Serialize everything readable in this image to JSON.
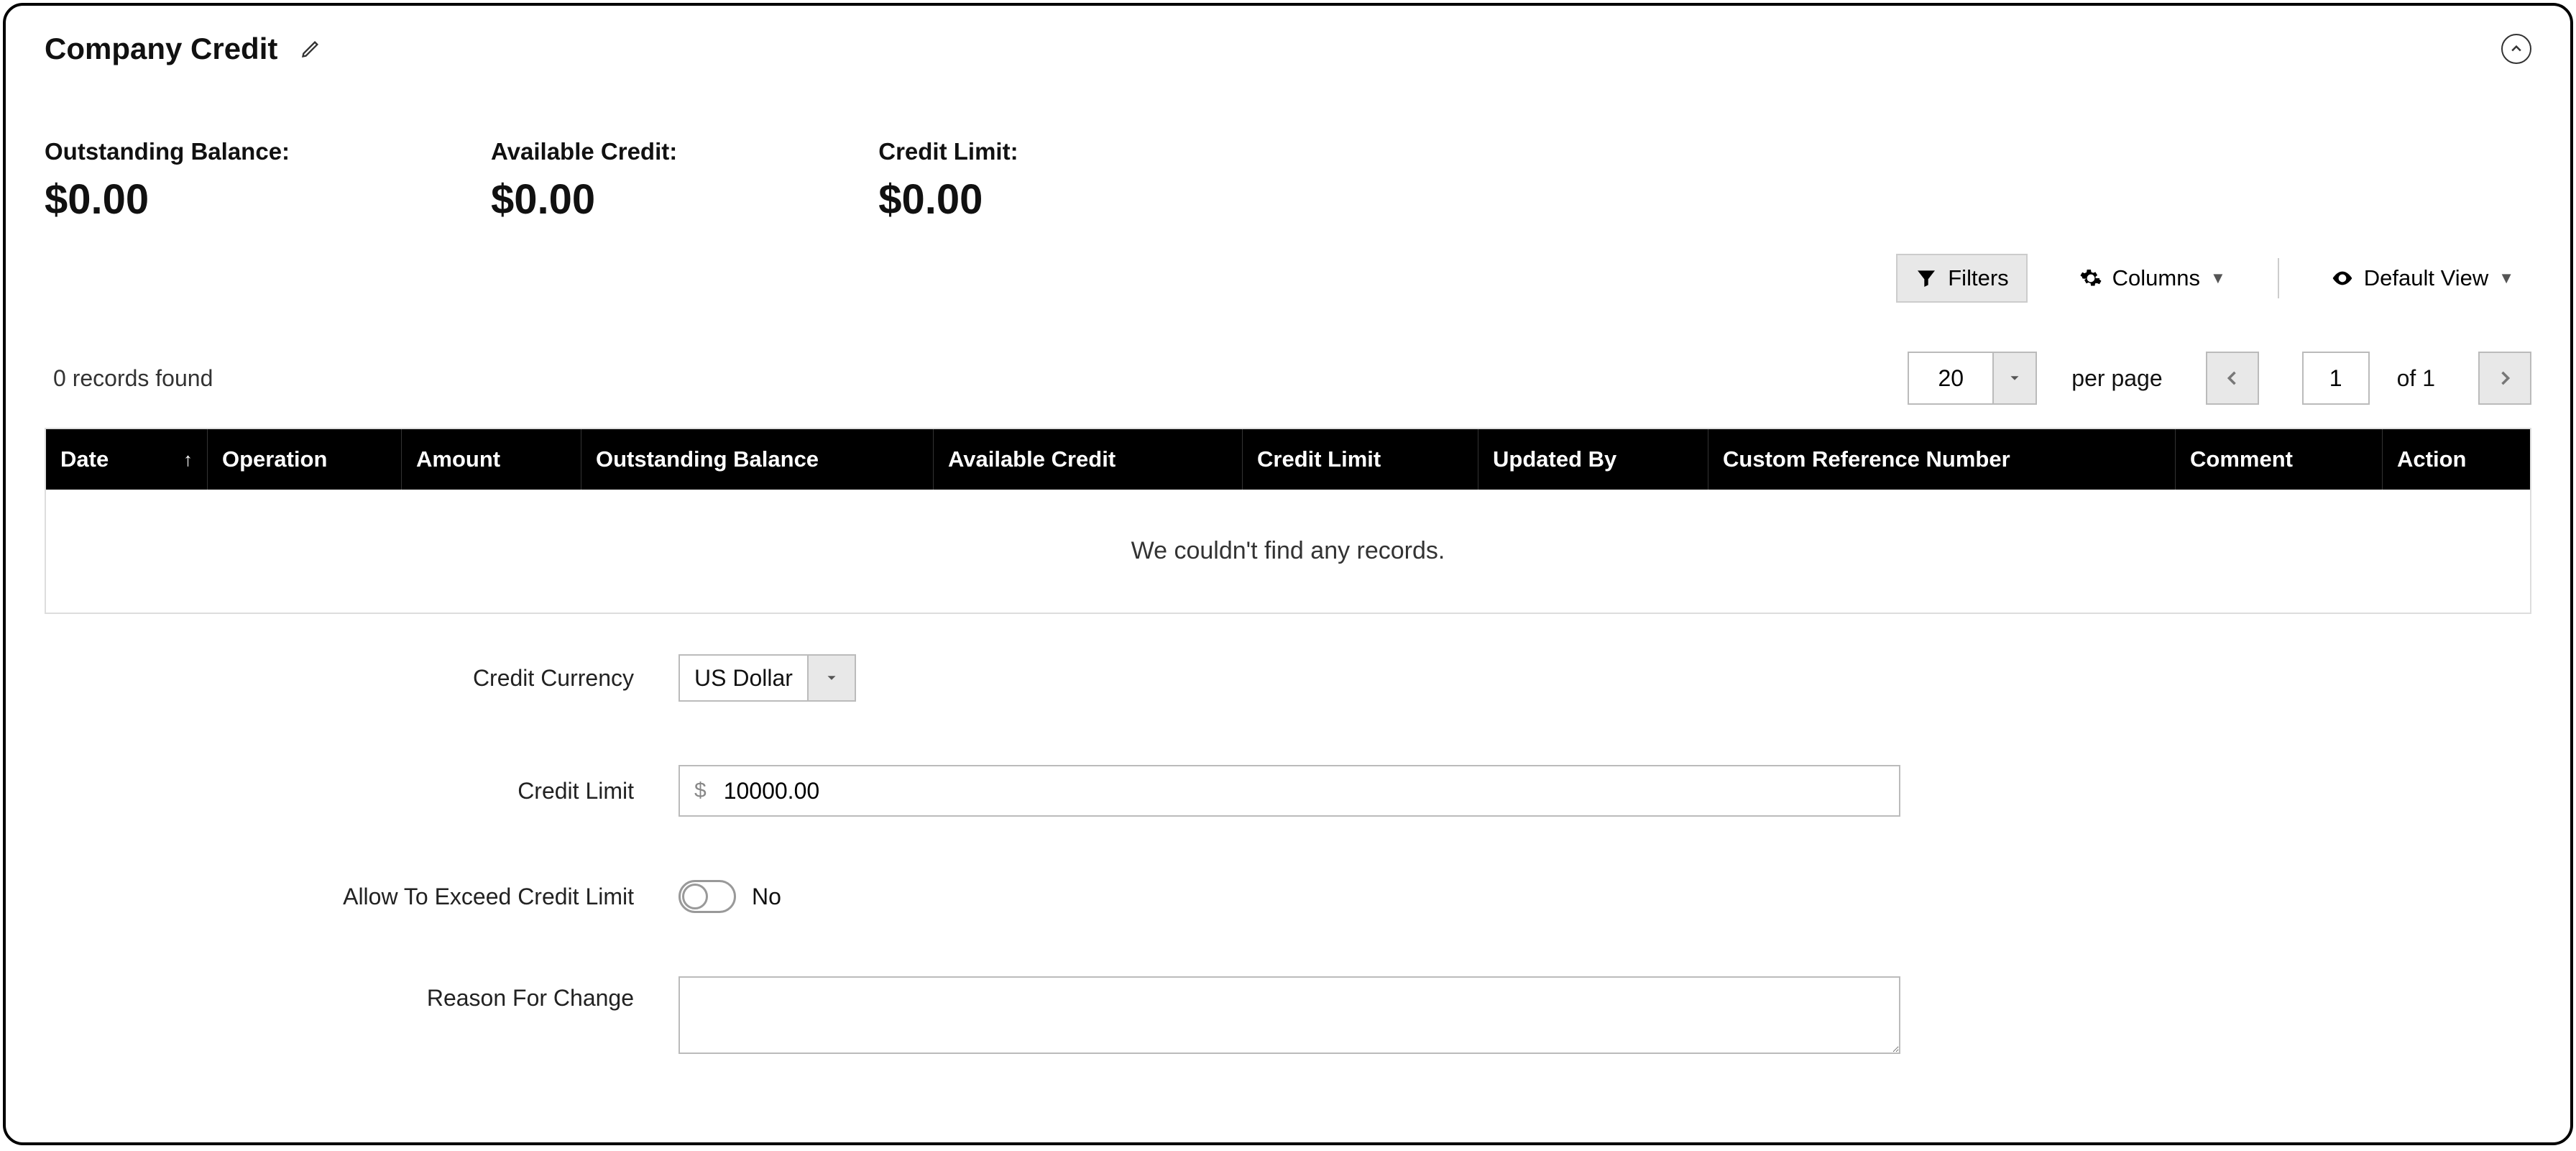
{
  "header": {
    "title": "Company Credit"
  },
  "summary": {
    "outstanding_label": "Outstanding Balance:",
    "outstanding_value": "$0.00",
    "available_label": "Available Credit:",
    "available_value": "$0.00",
    "limit_label": "Credit Limit:",
    "limit_value": "$0.00"
  },
  "toolbar": {
    "filters": "Filters",
    "columns": "Columns",
    "default_view": "Default View"
  },
  "records": {
    "found": "0 records found",
    "per_page_value": "20",
    "per_page_label": "per page",
    "page_num": "1",
    "of_total": "of 1"
  },
  "grid": {
    "headers": {
      "date": "Date",
      "operation": "Operation",
      "amount": "Amount",
      "outstanding": "Outstanding Balance",
      "available": "Available Credit",
      "limit": "Credit Limit",
      "updated_by": "Updated By",
      "custom_ref": "Custom Reference Number",
      "comment": "Comment",
      "action": "Action"
    },
    "empty": "We couldn't find any records."
  },
  "form": {
    "currency_label": "Credit Currency",
    "currency_value": "US Dollar",
    "limit_label": "Credit Limit",
    "limit_prefix": "$",
    "limit_value": "10000.00",
    "exceed_label": "Allow To Exceed Credit Limit",
    "exceed_value": "No",
    "reason_label": "Reason For Change",
    "reason_value": ""
  }
}
